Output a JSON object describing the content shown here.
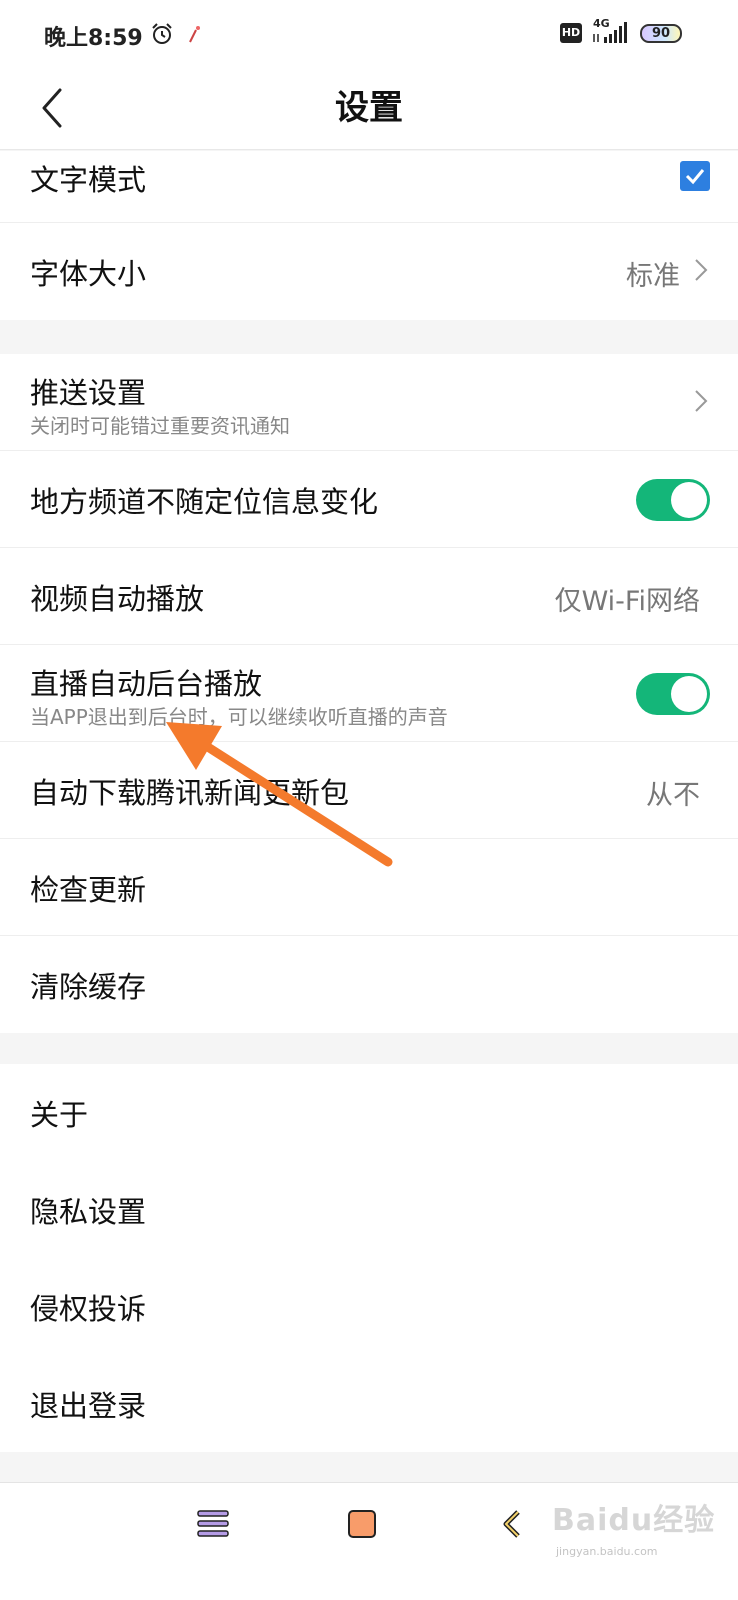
{
  "status_bar": {
    "time": "晚上8:59",
    "hd": "HD",
    "network": "4G",
    "battery": "90"
  },
  "header": {
    "title": "设置",
    "back_icon": "chevron-left-icon"
  },
  "sections": [
    {
      "rows": [
        {
          "label": "文字模式",
          "control": "checkbox",
          "checked": true
        },
        {
          "label": "字体大小",
          "value": "标准",
          "control": "chevron"
        }
      ]
    },
    {
      "rows": [
        {
          "label": "推送设置",
          "sub": "关闭时可能错过重要资讯通知",
          "control": "chevron"
        },
        {
          "label": "地方频道不随定位信息变化",
          "control": "toggle",
          "on": true
        },
        {
          "label": "视频自动播放",
          "value": "仅Wi-Fi网络"
        },
        {
          "label": "直播自动后台播放",
          "sub": "当APP退出到后台时，可以继续收听直播的声音",
          "control": "toggle",
          "on": true
        },
        {
          "label": "自动下载腾讯新闻更新包",
          "value": "从不"
        },
        {
          "label": "检查更新"
        },
        {
          "label": "清除缓存"
        }
      ]
    },
    {
      "rows": [
        {
          "label": "关于"
        },
        {
          "label": "隐私设置"
        },
        {
          "label": "侵权投诉"
        },
        {
          "label": "退出登录"
        }
      ]
    }
  ],
  "colors": {
    "toggle_on": "#14b679",
    "checkbox": "#2d7fe0",
    "annotation_arrow": "#f47a2c"
  },
  "watermark": {
    "text": "Baidu经验",
    "sub": "jingyan.baidu.com"
  }
}
